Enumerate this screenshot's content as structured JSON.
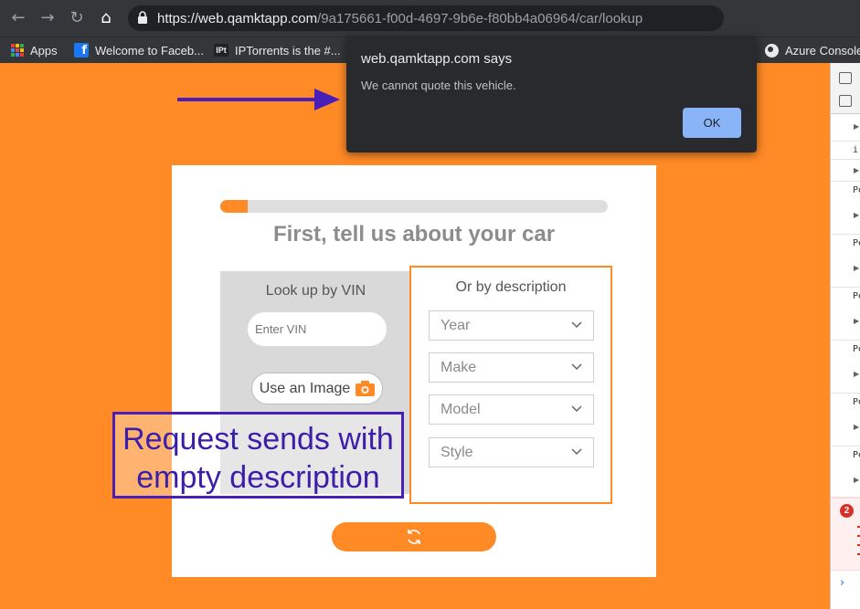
{
  "browser": {
    "url_host": "https://web.qamktapp.com",
    "url_path": "/9a175661-f00d-4697-9b6e-f80bb4a06964/car/lookup",
    "nav_icons": [
      "back-icon",
      "forward-icon",
      "reload-icon",
      "home-icon",
      "lock-icon"
    ],
    "bookmarks": [
      {
        "label": "Apps",
        "icon": "apps-grid-icon"
      },
      {
        "label": "Welcome to Faceb...",
        "icon": "facebook-icon"
      },
      {
        "label": "IPTorrents is the #...",
        "icon": "iptorrents-icon"
      },
      {
        "label": "Azure Console",
        "icon": "globe-icon"
      }
    ],
    "iptorrents_icon_text": "IPt"
  },
  "alert": {
    "title": "web.qamktapp.com says",
    "message": "We cannot quote this vehicle.",
    "ok_label": "OK",
    "ok_color": "#8ab4f8"
  },
  "page": {
    "accent_color": "#ff8a26",
    "progress_fraction": 0.07,
    "title": "First, tell us about your car",
    "vin": {
      "heading": "Look up by VIN",
      "placeholder": "Enter VIN",
      "value": "",
      "image_button_label": "Use an Image"
    },
    "description": {
      "heading": "Or by description",
      "selects": [
        {
          "placeholder": "Year"
        },
        {
          "placeholder": "Make"
        },
        {
          "placeholder": "Model"
        },
        {
          "placeholder": "Style"
        }
      ]
    }
  },
  "annotation": {
    "line1": "Request sends with",
    "line2": "empty description",
    "color": "#4a1fb8"
  },
  "devtools": {
    "row_texts": [
      "i",
      "Pe",
      "Pe",
      "Pe",
      "Pe",
      "Pe",
      "Pe"
    ],
    "error_count": "2"
  }
}
